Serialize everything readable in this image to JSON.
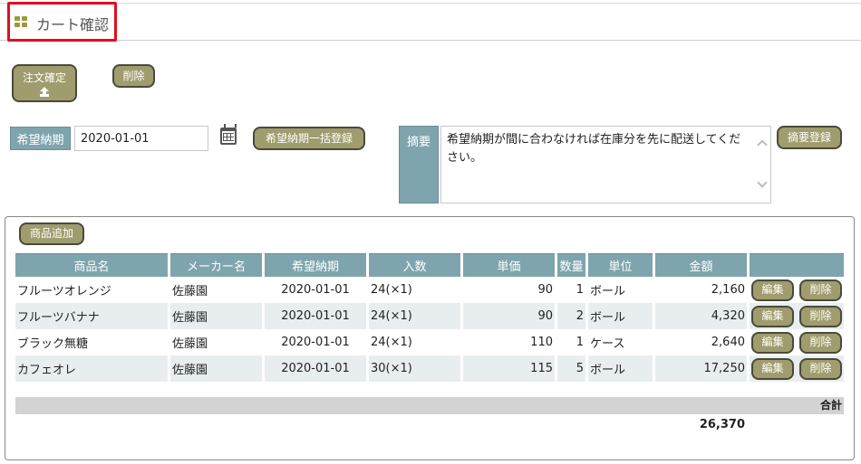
{
  "header": {
    "title": "カート確認",
    "icon": "grid-icon"
  },
  "toolbar": {
    "order_confirm_label": "注文確定",
    "delete_label": "削除"
  },
  "delivery": {
    "label": "希望納期",
    "value": "2020-01-01",
    "bulk_button_label": "希望納期一括登録"
  },
  "memo": {
    "label": "摘要",
    "value": "希望納期が間に合わなければ在庫分を先に配送してください。",
    "register_button_label": "摘要登録"
  },
  "cart": {
    "add_button_label": "商品追加",
    "columns": [
      "商品名",
      "メーカー名",
      "希望納期",
      "入数",
      "単価",
      "数量",
      "単位",
      "金額",
      ""
    ],
    "rows": [
      {
        "name": "フルーツオレンジ",
        "maker": "佐藤園",
        "date": "2020-01-01",
        "pack": "24(×1)",
        "price": "90",
        "qty": "1",
        "unit": "ボール",
        "amount": "2,160"
      },
      {
        "name": "フルーツバナナ",
        "maker": "佐藤園",
        "date": "2020-01-01",
        "pack": "24(×1)",
        "price": "90",
        "qty": "2",
        "unit": "ボール",
        "amount": "4,320"
      },
      {
        "name": "ブラック無糖",
        "maker": "佐藤園",
        "date": "2020-01-01",
        "pack": "24(×1)",
        "price": "110",
        "qty": "1",
        "unit": "ケース",
        "amount": "2,640"
      },
      {
        "name": "カフェオレ",
        "maker": "佐藤園",
        "date": "2020-01-01",
        "pack": "30(×1)",
        "price": "115",
        "qty": "5",
        "unit": "ボール",
        "amount": "17,250"
      }
    ],
    "edit_label": "編集",
    "row_delete_label": "削除",
    "total_label": "合計",
    "total_value": "26,370"
  },
  "colors": {
    "button": "#9f9c6e",
    "header_cell": "#7ea5ae",
    "highlight_border": "#e0101d"
  }
}
